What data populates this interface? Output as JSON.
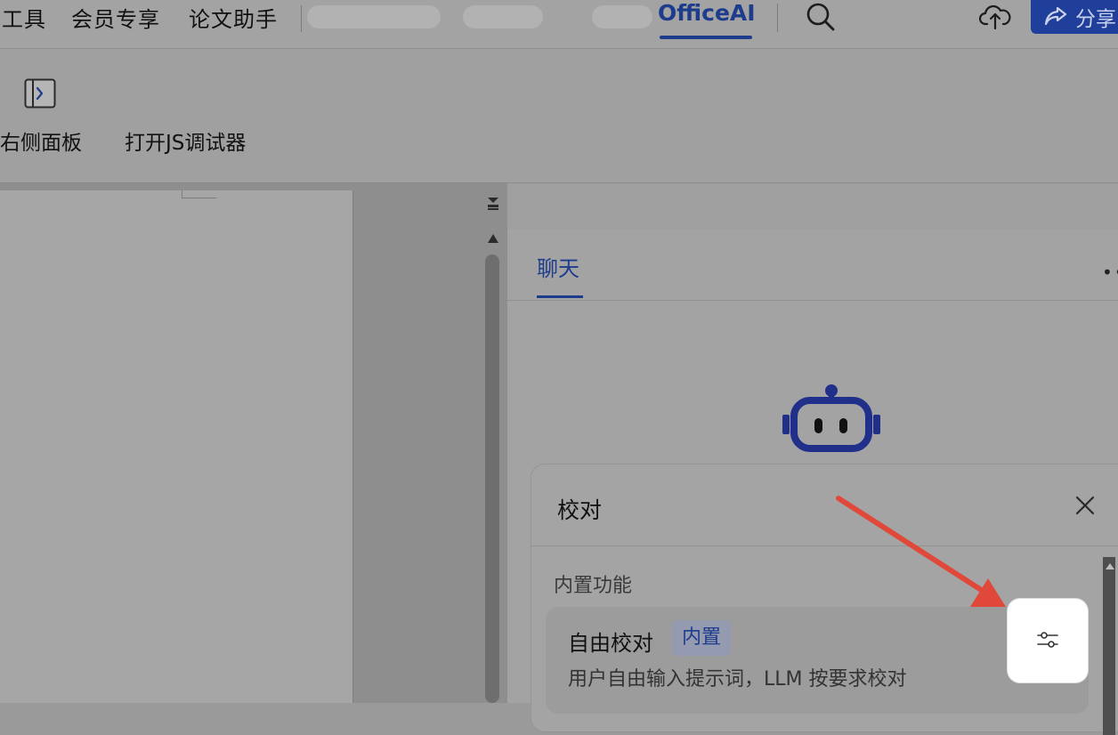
{
  "menubar": {
    "items": [
      "工具",
      "会员专享",
      "论文助手"
    ],
    "active_tab": "OfficeAI"
  },
  "ribbon": {
    "right_panel_label": "右侧面板",
    "js_debugger_label": "打开JS调试器"
  },
  "header": {
    "share_label": "分享"
  },
  "side_panel": {
    "chat_tab": "聊天",
    "more_icon": "more-horizontal-icon"
  },
  "popup": {
    "title": "校对",
    "section_label": "内置功能",
    "item": {
      "title": "自由校对",
      "badge": "内置",
      "description": "用户自由输入提示词，LLM 按要求校对"
    }
  },
  "colors": {
    "accent": "#1e3c8c",
    "annotation_arrow": "#e0483a",
    "highlight_button_bg": "#ffffff"
  }
}
